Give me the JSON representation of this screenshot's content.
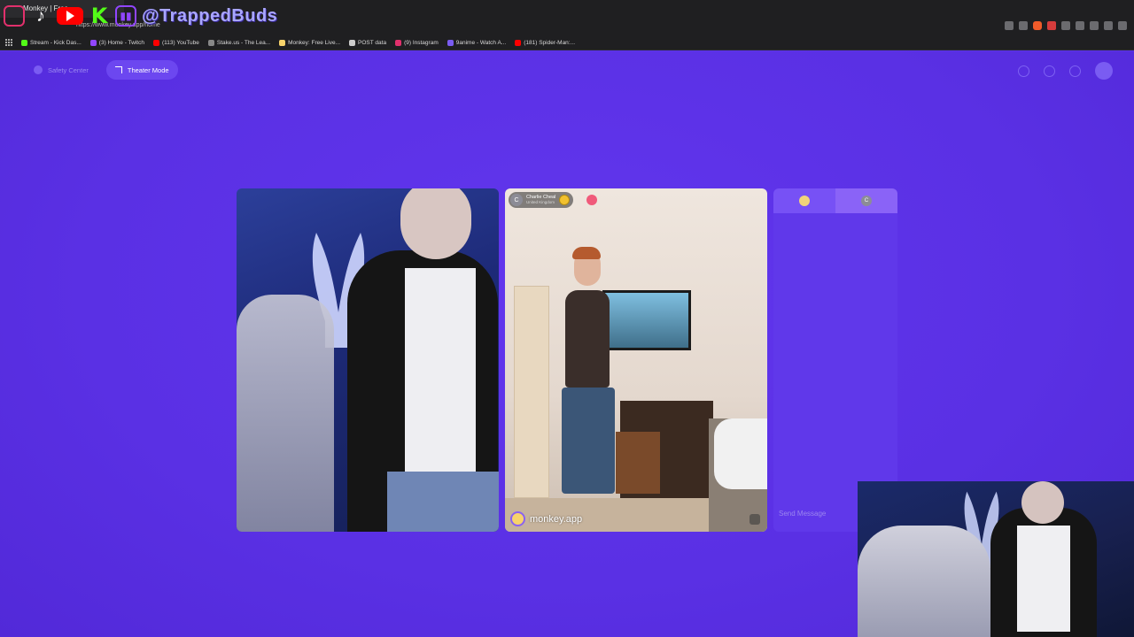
{
  "browser": {
    "tab_title": "Monkey | Free",
    "url": "https://www.monkey.app/home",
    "bookmarks": [
      {
        "label": "Stream - Kick Das..."
      },
      {
        "label": "(3) Home - Twitch"
      },
      {
        "label": "(113) YouTube"
      },
      {
        "label": "Stake.us - The Lea..."
      },
      {
        "label": "Monkey: Free Live..."
      },
      {
        "label": "POST data"
      },
      {
        "label": "(9) Instagram"
      },
      {
        "label": "9anime - Watch A..."
      },
      {
        "label": "(181) Spider-Man:..."
      }
    ]
  },
  "overlay": {
    "handle": "@TrappedBuds",
    "kick_letter": "K"
  },
  "app": {
    "nav": {
      "safety_center": "Safety Center",
      "theater_mode": "Theater Mode"
    },
    "remote_user": {
      "avatar_letter": "C",
      "name": "Charlie Cheal",
      "location": "United Kingdom"
    },
    "watermark": "monkey.app",
    "chat": {
      "tab2_letter": "C",
      "send_placeholder": "Send Message"
    }
  },
  "colors": {
    "background": "#5b32e6",
    "accent": "#6c47f0"
  }
}
